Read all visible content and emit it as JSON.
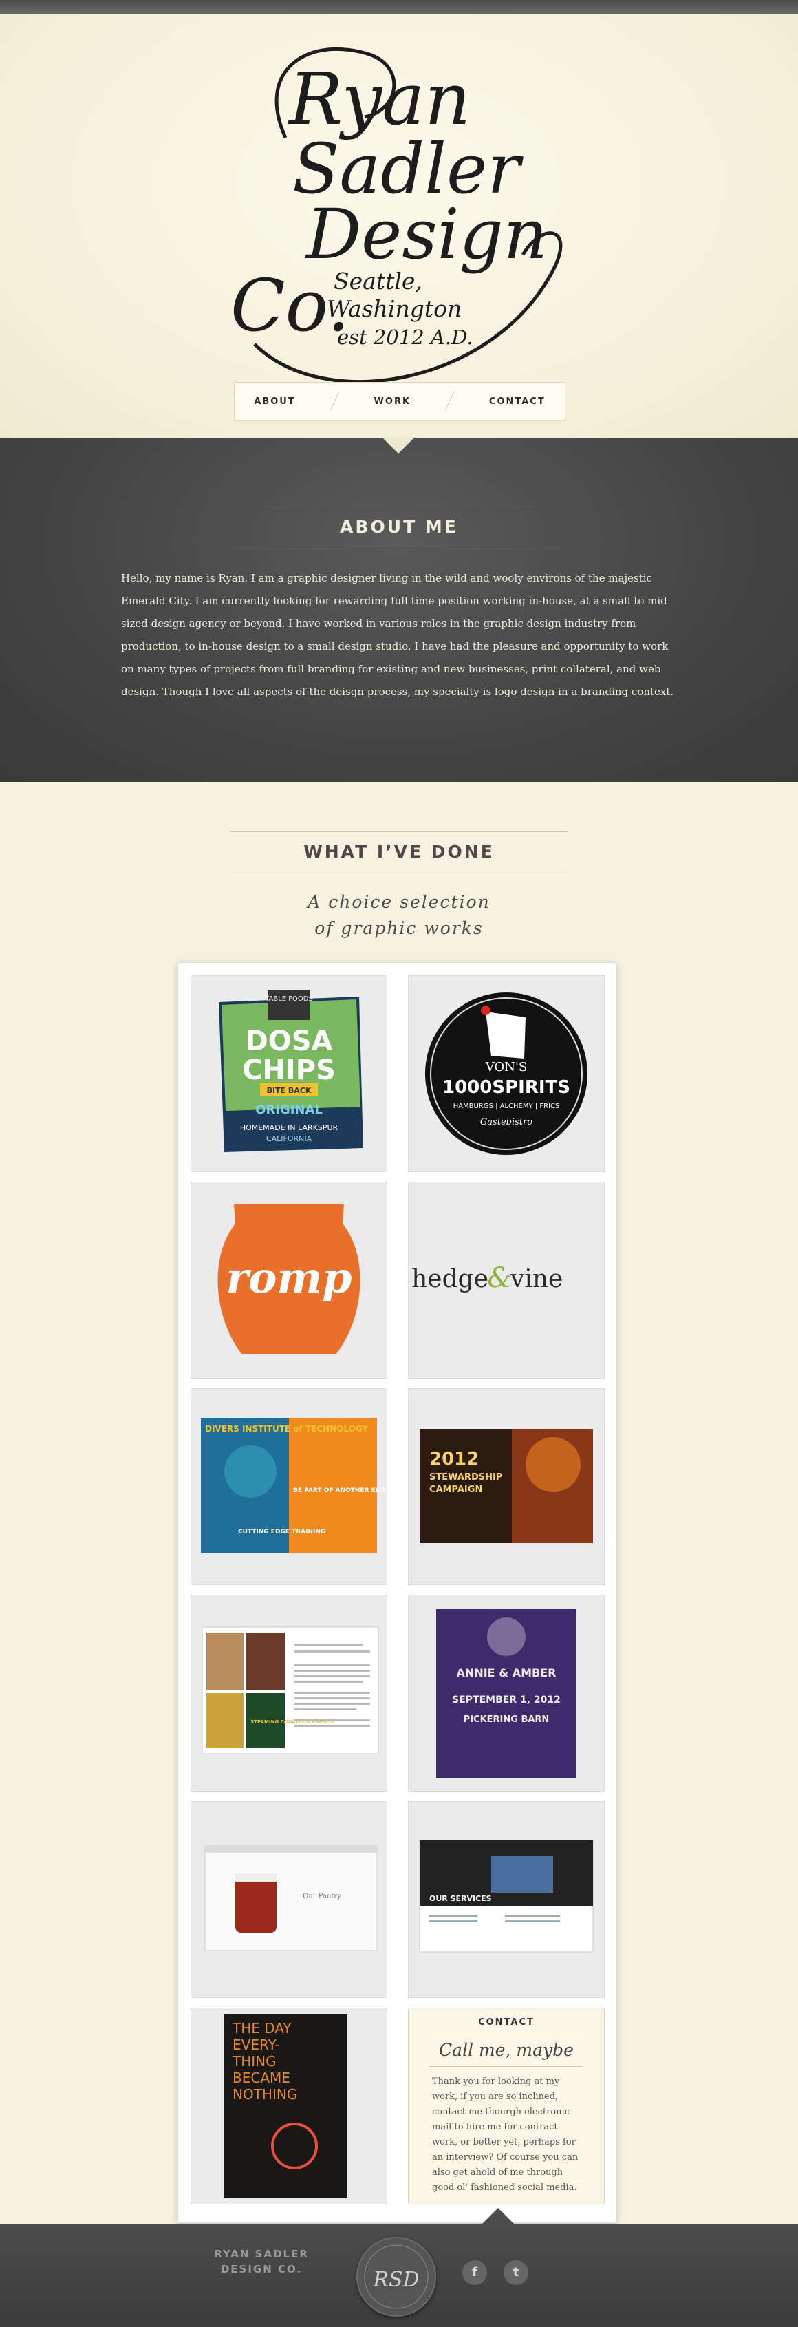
{
  "header": {
    "logo_lines": [
      "Ryan",
      "Sadler",
      "Design",
      "Co."
    ],
    "location": [
      "Seattle,",
      "Washington"
    ],
    "est": "est 2012 A.D.",
    "nav": [
      "ABOUT",
      "WORK",
      "CONTACT"
    ]
  },
  "about": {
    "heading": "ABOUT ME",
    "body": "Hello, my name is Ryan.  I am a graphic designer living in the wild and wooly environs of the majestic Emerald City.  I am currently looking for rewarding full time position working in-house, at a small to mid sized design agency or beyond.  I have worked in various roles in the graphic design industry from production, to in-house design to a small design studio.  I have had the pleasure and opportunity to work on many types of projects from full branding for existing and new businesses, print collateral, and web design.  Though I love all aspects of the deisgn process, my specialty is logo design in a branding context."
  },
  "work": {
    "heading": "WHAT I’VE DONE",
    "tagline": [
      "A choice selection",
      "of graphic works"
    ],
    "tiles": [
      {
        "name": "dosa-chips",
        "text": [
          "TABLE FOODS",
          "DOSA",
          "CHIPS",
          "BITE BACK",
          "ORIGINAL",
          "HOMEMADE IN LARKSPUR",
          "CALIFORNIA"
        ]
      },
      {
        "name": "vons-1000-spirits",
        "text": [
          "VON'S",
          "1000SPIRITS",
          "HAMBURGS | ALCHEMY | FRICS",
          "Gastebistro"
        ]
      },
      {
        "name": "romp",
        "text": [
          "romp"
        ]
      },
      {
        "name": "hedge-vine",
        "text": [
          "hedge",
          "&",
          "vine"
        ]
      },
      {
        "name": "divers-institute",
        "text": [
          "DIVERS INSTITUTE of TECHNOLOGY",
          "CUTTING EDGE TRAINING",
          "BE PART OF ANOTHER ELITE TEAM"
        ]
      },
      {
        "name": "stewardship-campaign",
        "text": [
          "2012",
          "STEWARDSHIP",
          "CAMPAIGN"
        ]
      },
      {
        "name": "recipe-spread",
        "text": [
          "STEAMING COOKIES & FRESCO"
        ]
      },
      {
        "name": "wedding-papercut",
        "text": [
          "ANNIE & AMBER",
          "SEPTEMBER 1, 2012",
          "PICKERING BARN"
        ]
      },
      {
        "name": "jam-website",
        "text": [
          "Our Pantry"
        ]
      },
      {
        "name": "services-website",
        "text": [
          "OUR SERVICES"
        ]
      },
      {
        "name": "book-cover",
        "text": [
          "THE DAY",
          "EVERY-",
          "THING",
          "BECAME",
          "NOTHING"
        ]
      }
    ]
  },
  "contact": {
    "heading": "CONTACT",
    "subhead": "Call me, maybe",
    "body": "Thank you for looking at my work, if you are so inclined, contact me thourgh electronic-mail to hire me for contract work, or better yet, perhaps for an interview? Of course you can also get ahold of me through good ol' fashioned social media."
  },
  "footer": {
    "name": [
      "RYAN SADLER",
      "DESIGN CO."
    ],
    "monogram": "RSD",
    "social": [
      "f",
      "t"
    ]
  },
  "colors": {
    "cream": "#f6f2e0",
    "charcoal": "#444444",
    "orange": "#e8702a",
    "purple": "#3f2a6b"
  }
}
